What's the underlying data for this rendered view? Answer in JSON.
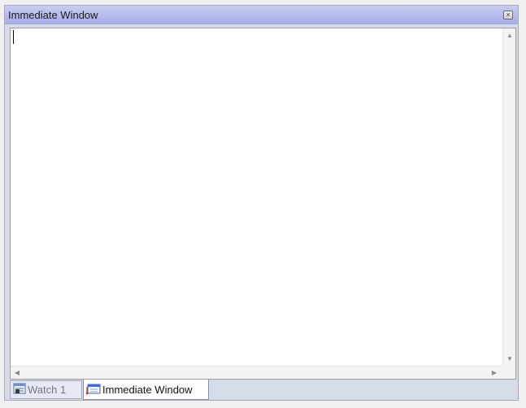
{
  "window": {
    "title": "Immediate Window",
    "close_glyph": "×"
  },
  "editor": {
    "content": ""
  },
  "scrollbars": {
    "up_glyph": "▲",
    "down_glyph": "▼",
    "left_glyph": "◀",
    "right_glyph": "▶"
  },
  "tabs": [
    {
      "label": "Watch 1",
      "icon": "watch-window-icon",
      "active": false
    },
    {
      "label": "Immediate Window",
      "icon": "immediate-window-icon",
      "active": true
    }
  ]
}
